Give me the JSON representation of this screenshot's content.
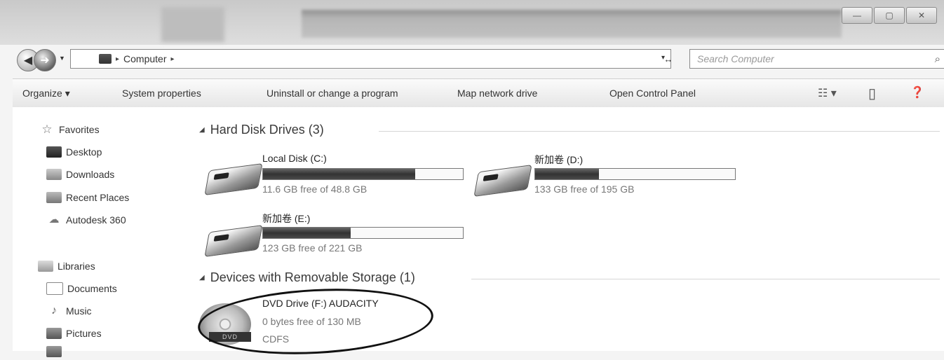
{
  "window": {
    "controls": [
      {
        "name": "minimize-button",
        "glyph": "—"
      },
      {
        "name": "maximize-button",
        "glyph": "▢"
      },
      {
        "name": "close-button",
        "glyph": "✕"
      }
    ]
  },
  "nav": {
    "back_glyph": "◀",
    "forward_glyph": "➜",
    "history_dropdown_glyph": "▼",
    "address_path": [
      "Computer"
    ],
    "address_separator": "▸",
    "address_dropdown_glyph": "▾",
    "refresh_glyph": "↔",
    "search_placeholder": "Search Computer",
    "search_icon": "search-icon"
  },
  "toolbar": {
    "organize": "Organize ▾",
    "system_properties": "System properties",
    "uninstall": "Uninstall or change a program",
    "map_network": "Map network drive",
    "control_panel": "Open Control Panel",
    "view_glyph": "☷ ▾",
    "preview_glyph": "▯",
    "help_glyph": "❓"
  },
  "sidebar": {
    "favorites_label": "Favorites",
    "favorites": [
      "Desktop",
      "Downloads",
      "Recent Places",
      "Autodesk 360"
    ],
    "libraries_label": "Libraries",
    "libraries": [
      "Documents",
      "Music",
      "Pictures"
    ]
  },
  "groups": {
    "hard_disks": "Hard Disk Drives (3)",
    "removable": "Devices with Removable Storage (1)"
  },
  "drives": [
    {
      "name": "Local Disk (C:)",
      "free": "11.6 GB free of 48.8 GB",
      "used_fraction": 0.76
    },
    {
      "name": "新加卷 (D:)",
      "free": "133 GB free of 195 GB",
      "used_fraction": 0.32
    },
    {
      "name": "新加卷 (E:)",
      "free": "123 GB free of 221 GB",
      "used_fraction": 0.44
    }
  ],
  "dvd": {
    "name": "DVD Drive (F:) AUDACITY",
    "free": "0 bytes free of 130 MB",
    "filesystem": "CDFS",
    "icon_label": "DVD"
  },
  "colors": {
    "bar_fill": "#3a3a3a",
    "annotation_circle": "#111111"
  }
}
